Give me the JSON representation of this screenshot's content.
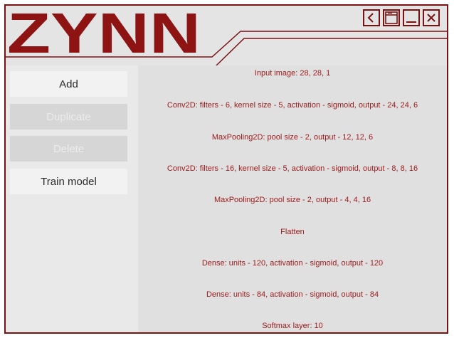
{
  "app": {
    "title": "ZYNN",
    "accent_color": "#7a1212"
  },
  "window_controls": [
    {
      "name": "back-button",
      "icon": "chevron-left-icon"
    },
    {
      "name": "restore-button",
      "icon": "window-restore-icon"
    },
    {
      "name": "minimize-button",
      "icon": "minimize-icon"
    },
    {
      "name": "close-button",
      "icon": "close-icon"
    }
  ],
  "sidebar": {
    "buttons": [
      {
        "label": "Add",
        "enabled": true
      },
      {
        "label": "Duplicate",
        "enabled": false
      },
      {
        "label": "Delete",
        "enabled": false
      },
      {
        "label": "Train model",
        "enabled": true
      }
    ]
  },
  "model": {
    "layers": [
      "Input image: 28, 28, 1",
      "Conv2D: filters - 6, kernel size - 5, activation - sigmoid, output - 24, 24, 6",
      "MaxPooling2D: pool size - 2, output - 12, 12, 6",
      "Conv2D: filters - 16, kernel size - 5, activation - sigmoid, output - 8, 8, 16",
      "MaxPooling2D: pool size - 2, output - 4, 4, 16",
      "Flatten",
      "Dense: units - 120, activation - sigmoid, output - 120",
      "Dense: units - 84, activation - sigmoid, output - 84",
      "Softmax layer: 10"
    ]
  }
}
